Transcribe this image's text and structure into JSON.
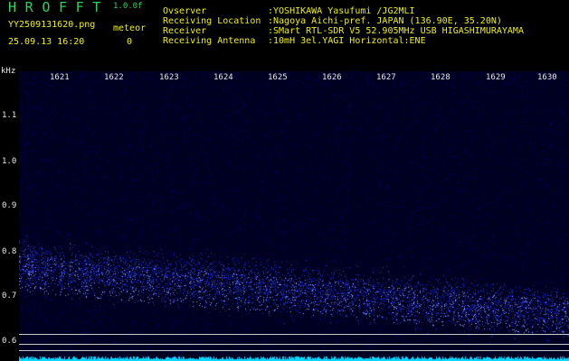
{
  "header": {
    "brand": "H R O F F T",
    "version": "1.0.0f",
    "filename": "YY2509131620.png",
    "timestamp": "25.09.13 16:20",
    "meteor_label": "meteor",
    "meteor_count": "0"
  },
  "info": [
    {
      "label": "Ovserver",
      "value": ":YOSHIKAWA Yasufumi /JG2MLI"
    },
    {
      "label": "Receiving Location",
      "value": ":Nagoya Aichi-pref. JAPAN (136.90E, 35.20N)"
    },
    {
      "label": "Receiver",
      "value": ":SMart RTL-SDR V5 52.905MHz USB HIGASHIMURAYAMA"
    },
    {
      "label": "Receiving Antenna",
      "value": ":10mH 3el.YAGI Horizontal:ENE"
    }
  ],
  "axis": {
    "y_unit": "kHz",
    "y_ticks": [
      "1.1",
      "1.0",
      "0.9",
      "0.8",
      "0.7",
      "0.6"
    ],
    "x_ticks": [
      "1621",
      "1622",
      "1623",
      "1624",
      "1625",
      "1626",
      "1627",
      "1628",
      "1629",
      "1630"
    ]
  },
  "colors": {
    "brand": "#2bd45a",
    "info_text": "#f0f000",
    "waterfall_bg": "#000020",
    "signal": "#4050ff",
    "noise_floor": "#00d8ff"
  }
}
